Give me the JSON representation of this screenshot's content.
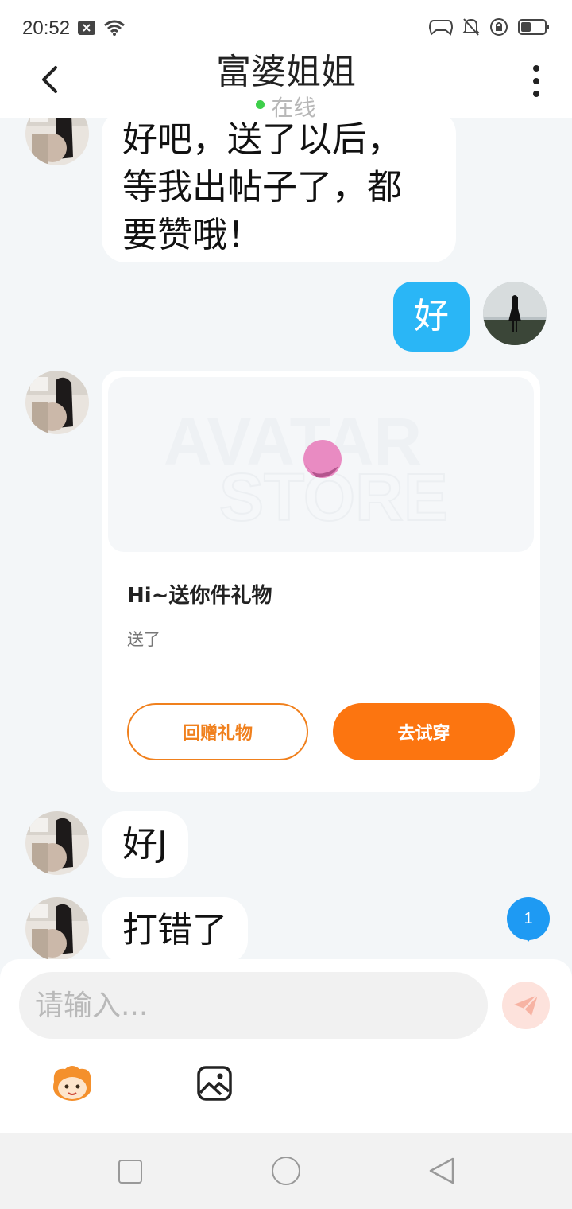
{
  "status_bar": {
    "time": "20:52"
  },
  "header": {
    "title": "富婆姐姐",
    "status": "在线",
    "status_color": "#3ecf4a"
  },
  "messages": [
    {
      "from": "other",
      "text_lines": [
        "好吧，送了以后，",
        "等我出帖子了，都",
        "要赞哦！"
      ]
    },
    {
      "from": "me",
      "text": "好"
    },
    {
      "from": "other",
      "type": "gift",
      "watermark_lines": [
        "AVATAR",
        "STORE"
      ],
      "title": "Hi~送你件礼物",
      "subtitle": "送了",
      "return_label": "回赠礼物",
      "try_label": "去试穿"
    },
    {
      "from": "other",
      "text": "好J"
    },
    {
      "from": "other",
      "text": "打错了"
    }
  ],
  "unread": {
    "count": "1"
  },
  "composer": {
    "placeholder": "请输入..."
  },
  "colors": {
    "accent_blue": "#2ab6f6",
    "accent_orange": "#fc7510"
  },
  "icons": [
    "back-arrow-icon",
    "more-vertical-icon",
    "send-icon",
    "emoji-mascot-icon",
    "image-icon",
    "nav-square-icon",
    "nav-circle-icon",
    "nav-back-icon"
  ]
}
